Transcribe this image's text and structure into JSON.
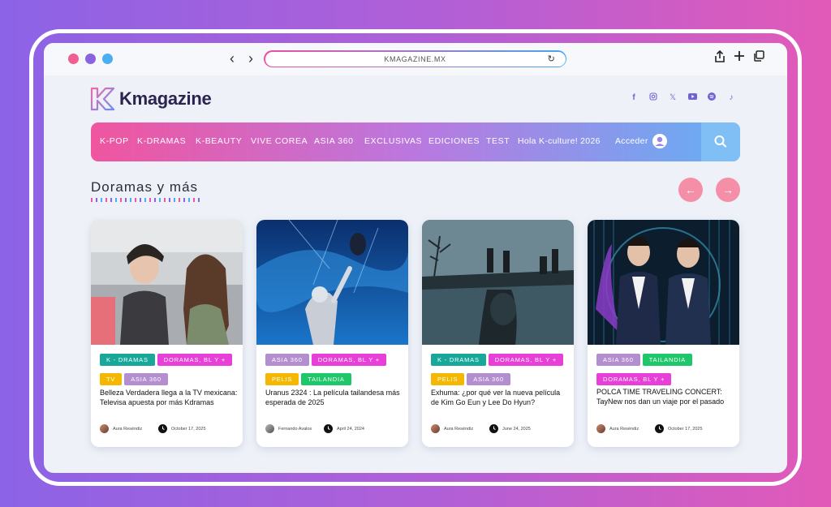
{
  "browser": {
    "url": "KMAGAZINE.MX",
    "traffic_lights": [
      "#f05f8f",
      "#8a63e0",
      "#4aaef0"
    ]
  },
  "site": {
    "logo_text": "Kmagazine",
    "socials": [
      "facebook-icon",
      "instagram-icon",
      "x-icon",
      "youtube-icon",
      "spotify-icon",
      "tiktok-icon"
    ]
  },
  "nav": {
    "items": [
      "K-POP",
      "K-DRAMAS",
      "K-BEAUTY",
      "VIVE COREA",
      "ASIA 360",
      "EXCLUSIVAS",
      "EDICIONES",
      "TEST",
      "Hola K-culture! 2026"
    ],
    "login_label": "Acceder"
  },
  "section": {
    "title": "Doramas y más"
  },
  "cards": [
    {
      "tags": [
        "K - DRAMAS",
        "DORAMAS, BL Y +",
        "TV",
        "ASIA 360"
      ],
      "title": "Belleza Verdadera llega a la TV mexicana: Televisa apuesta por más Kdramas",
      "author": "Aura Reséndiz",
      "date": "October 17, 2025"
    },
    {
      "tags": [
        "ASIA 360",
        "DORAMAS, BL Y +",
        "PELIS",
        "TAILANDIA"
      ],
      "title": "Uranus 2324 : La película tailandesa más esperada de 2025",
      "author": "Fernando Avalos",
      "date": "April 24, 2024"
    },
    {
      "tags": [
        "K - DRAMAS",
        "DORAMAS, BL Y +",
        "PELIS",
        "ASIA 360"
      ],
      "title": "Exhuma: ¿por qué ver la nueva película de Kim Go Eun y Lee Do Hyun?",
      "author": "Aura Reséndiz",
      "date": "June 24, 2025"
    },
    {
      "tags": [
        "ASIA 360",
        "TAILANDIA",
        "DORAMAS, BL Y +"
      ],
      "title": "POLCA TIME TRAVELING CONCERT: TayNew nos dan un viaje por el pasado",
      "author": "Aura Reséndiz",
      "date": "October 17, 2025"
    }
  ],
  "tag_colors": {
    "K - DRAMAS": "#17a89a",
    "DORAMAS, BL Y +": "#e83fd8",
    "TV": "#f5b800",
    "ASIA 360": "#b48fd0",
    "PELIS": "#f5b800",
    "TAILANDIA": "#1fc76b"
  }
}
